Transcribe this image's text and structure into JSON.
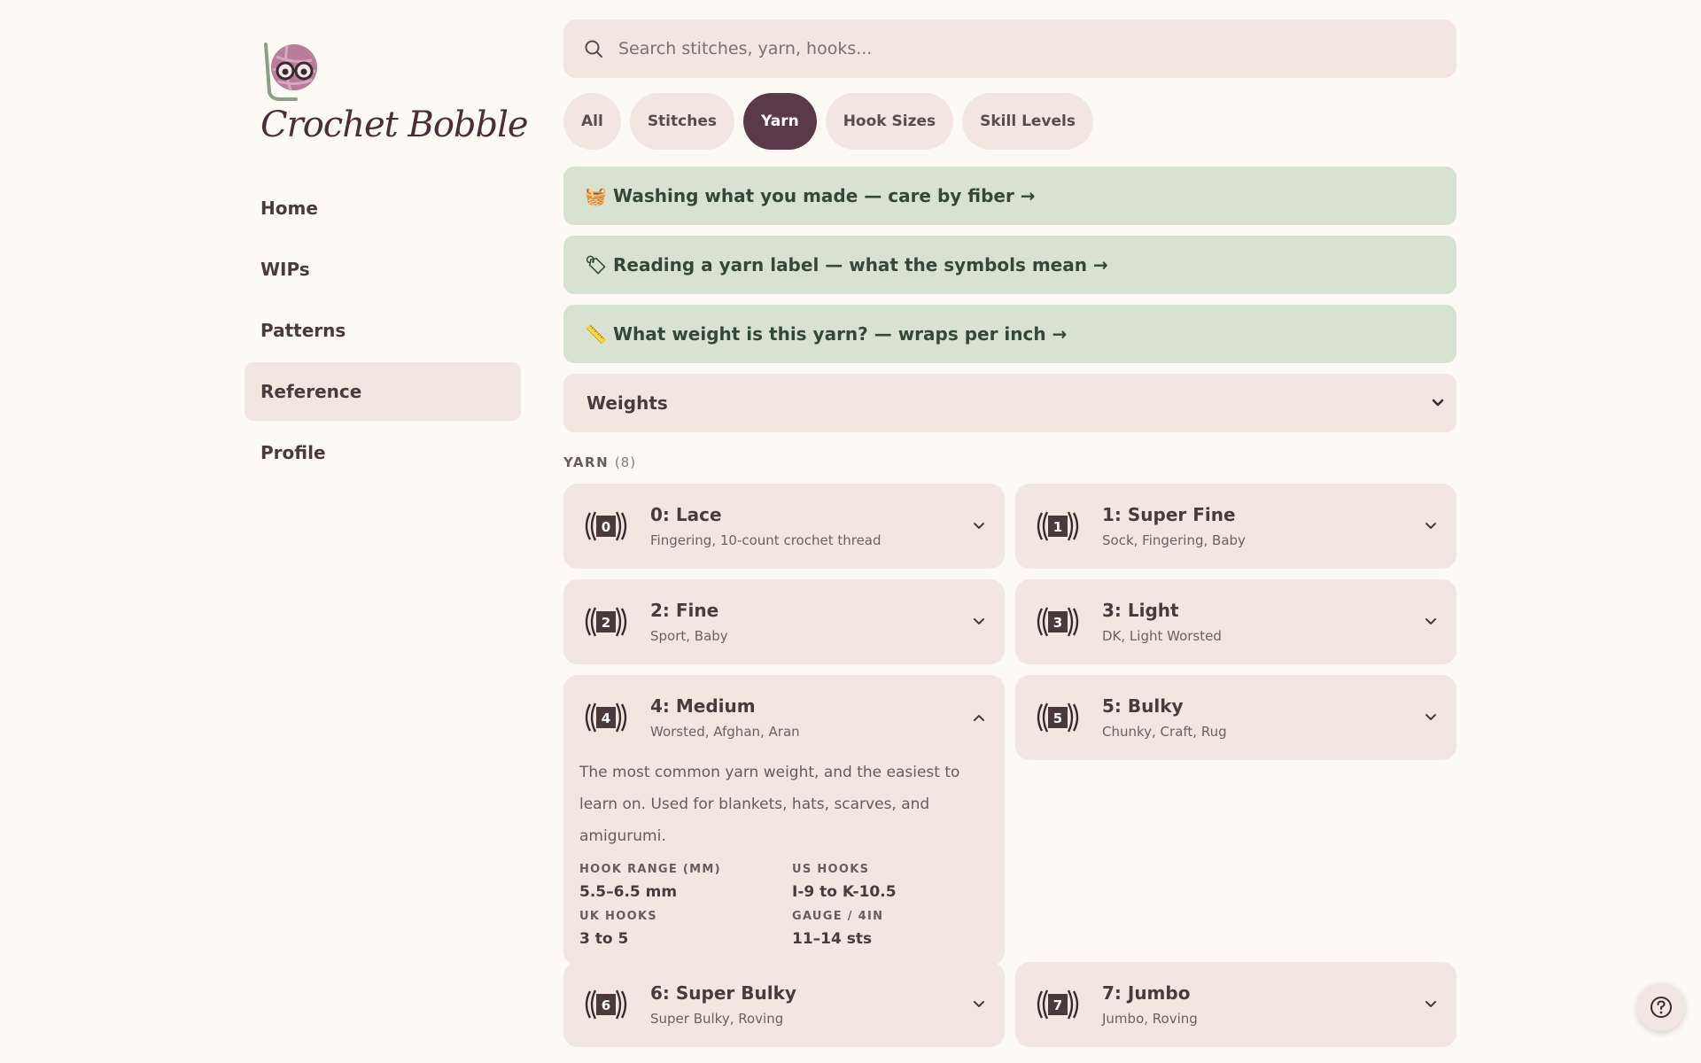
{
  "brand": {
    "name": "Crochet Bobble",
    "logo_icon": "yarn-ball-glasses-icon"
  },
  "nav": {
    "items": [
      {
        "label": "Home",
        "active": false
      },
      {
        "label": "WIPs",
        "active": false
      },
      {
        "label": "Patterns",
        "active": false
      },
      {
        "label": "Reference",
        "active": true
      },
      {
        "label": "Profile",
        "active": false
      }
    ]
  },
  "search": {
    "placeholder": "Search stitches, yarn, hooks...",
    "value": "",
    "icon": "search-icon"
  },
  "filters": {
    "chips": [
      {
        "label": "All",
        "active": false
      },
      {
        "label": "Stitches",
        "active": false
      },
      {
        "label": "Yarn",
        "active": true
      },
      {
        "label": "Hook Sizes",
        "active": false
      },
      {
        "label": "Skill Levels",
        "active": false
      }
    ]
  },
  "banners": [
    {
      "icon": "🧺",
      "icon_name": "basket-icon",
      "text": "Washing what you made — care by fiber →"
    },
    {
      "icon": "🏷",
      "icon_name": "tag-icon",
      "text": "Reading a yarn label — what the symbols mean →"
    },
    {
      "icon": "📏",
      "icon_name": "ruler-icon",
      "text": "What weight is this yarn? — wraps per inch →"
    }
  ],
  "category_select": {
    "value": "Weights"
  },
  "section": {
    "label": "YARN",
    "count": "(8)"
  },
  "yarn_weights": [
    {
      "number": "0",
      "title": "0: Lace",
      "subtitle": "Fingering, 10-count crochet thread",
      "expanded": false
    },
    {
      "number": "1",
      "title": "1: Super Fine",
      "subtitle": "Sock, Fingering, Baby",
      "expanded": false
    },
    {
      "number": "2",
      "title": "2: Fine",
      "subtitle": "Sport, Baby",
      "expanded": false
    },
    {
      "number": "3",
      "title": "3: Light",
      "subtitle": "DK, Light Worsted",
      "expanded": false
    },
    {
      "number": "4",
      "title": "4: Medium",
      "subtitle": "Worsted, Afghan, Aran",
      "expanded": true,
      "description": "The most common yarn weight, and the easiest to learn on. Used for blankets, hats, scarves, and amigurumi.",
      "specs": [
        {
          "label": "HOOK RANGE (MM)",
          "value": "5.5–6.5 mm"
        },
        {
          "label": "US HOOKS",
          "value": "I-9 to K-10.5"
        },
        {
          "label": "UK HOOKS",
          "value": "3 to 5"
        },
        {
          "label": "GAUGE / 4IN",
          "value": "11–14 sts"
        }
      ]
    },
    {
      "number": "5",
      "title": "5: Bulky",
      "subtitle": "Chunky, Craft, Rug",
      "expanded": false
    },
    {
      "number": "6",
      "title": "6: Super Bulky",
      "subtitle": "Super Bulky, Roving",
      "expanded": false
    },
    {
      "number": "7",
      "title": "7: Jumbo",
      "subtitle": "Jumbo, Roving",
      "expanded": false
    }
  ],
  "help": {
    "icon": "help-icon"
  },
  "colors": {
    "background": "#fdfaf5",
    "card": "#f3e6e0",
    "banner": "#d7e3d0",
    "accent": "#5a3a48",
    "text": "#4a3a3e"
  }
}
